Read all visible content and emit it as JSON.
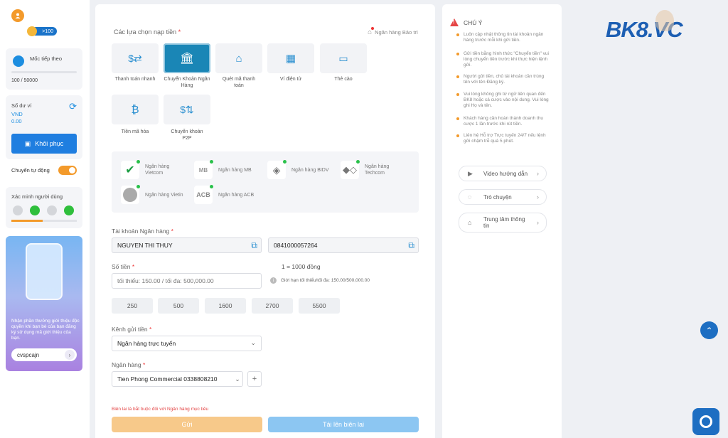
{
  "sidebar": {
    "points_badge": ">100",
    "milestone_label": "Mốc tiếp theo",
    "milestone_progress": "100 / 50000",
    "balance_label": "Số dư ví",
    "balance_currency": "VND",
    "balance_amount": "0.00",
    "restore_button": "Khôi phục",
    "auto_transfer_label": "Chuyển tự động",
    "verify_label": "Xác minh người dùng",
    "promo_text": "Nhận phần thưởng giới thiệu độc quyền khi bạn bè của bạn đăng ký sử dụng mã giới thiệu của bạn.",
    "referral_code": "cvspcajn"
  },
  "main": {
    "options_title": "Các lựa chọn nạp tiền",
    "maintenance_label": "Ngân hàng Bảo trì",
    "options": [
      {
        "label": "Thanh toán nhanh"
      },
      {
        "label": "Chuyển Khoản Ngân Hàng"
      },
      {
        "label": "Quét mã thanh toán"
      },
      {
        "label": "Ví điện tử"
      },
      {
        "label": "Thẻ cào"
      },
      {
        "label": "Tiền mã hóa"
      },
      {
        "label": "Chuyển khoản P2P"
      }
    ],
    "banks": [
      {
        "name": "Ngân hàng Vietcom"
      },
      {
        "name": "Ngân hàng MB"
      },
      {
        "name": "Ngân hàng BIDV"
      },
      {
        "name": "Ngân hàng Techcom"
      },
      {
        "name": "Ngân hàng Vietin"
      },
      {
        "name": "Ngân hàng ACB"
      }
    ],
    "bank_logos": {
      "mb": "MB",
      "acb": "ACB"
    },
    "account_label": "Tài khoản Ngân hàng",
    "account_name": "NGUYEN THI THUY",
    "account_number": "0841000057264",
    "amount_label": "Số tiền",
    "rate_text": "1 = 1000 đồng",
    "amount_placeholder": "tối thiểu: 150.00 / tối đa: 500,000.00",
    "limit_text": "Giới hạn tối thiểu/tối đa: 150.00/500,000.00",
    "quick_amounts": [
      "250",
      "500",
      "1600",
      "2700",
      "5500"
    ],
    "channel_label": "Kênh gửi tiền",
    "channel_value": "Ngân hàng trực tuyến",
    "bank_label": "Ngân hàng",
    "bank_value": "Tien Phong Commercial 0338808210",
    "add_symbol": "+",
    "receipt_note": "Biên lai là bắt buộc đối với Ngân hàng mục tiêu",
    "submit_button": "Gửi",
    "upload_button": "Tải lên biên lai",
    "required_mark": "*"
  },
  "notes": {
    "title": "CHÚ Ý",
    "items": [
      "Luôn cập nhật thông tin tài khoản ngân hàng trước mỗi khi gửi tiền.",
      "Gửi tiền bằng hình thức \"Chuyển tiền\" vui lòng chuyển tiền trước khi thực hiện lệnh gửi.",
      "Người gửi tiền, chủ tài khoản cần trùng tên với tên Đăng ký.",
      "Vui lòng không ghi từ ngữ liên quan đến BK8 hoặc cá cược vào nội dung. Vui lòng ghi Họ và tên.",
      "Khách hàng cần hoàn thành doanh thu cược 1 lần trước khi rút tiền.",
      "Liên hệ Hỗ trợ Trực tuyến 24/7 nếu lệnh gửi chậm trễ quá 5 phút."
    ],
    "help": [
      {
        "label": "Video hướng dẫn"
      },
      {
        "label": "Trò chuyện"
      },
      {
        "label": "Trung tâm thông tin"
      }
    ]
  },
  "brand": {
    "logo": "BK8.VC"
  },
  "colors": {
    "accent": "#1a86b6",
    "primary_button": "#1f7ee0",
    "submit": "#f7c98a",
    "upload": "#8cc6f2",
    "warning": "#e54545",
    "dot": "#f39a2b"
  }
}
